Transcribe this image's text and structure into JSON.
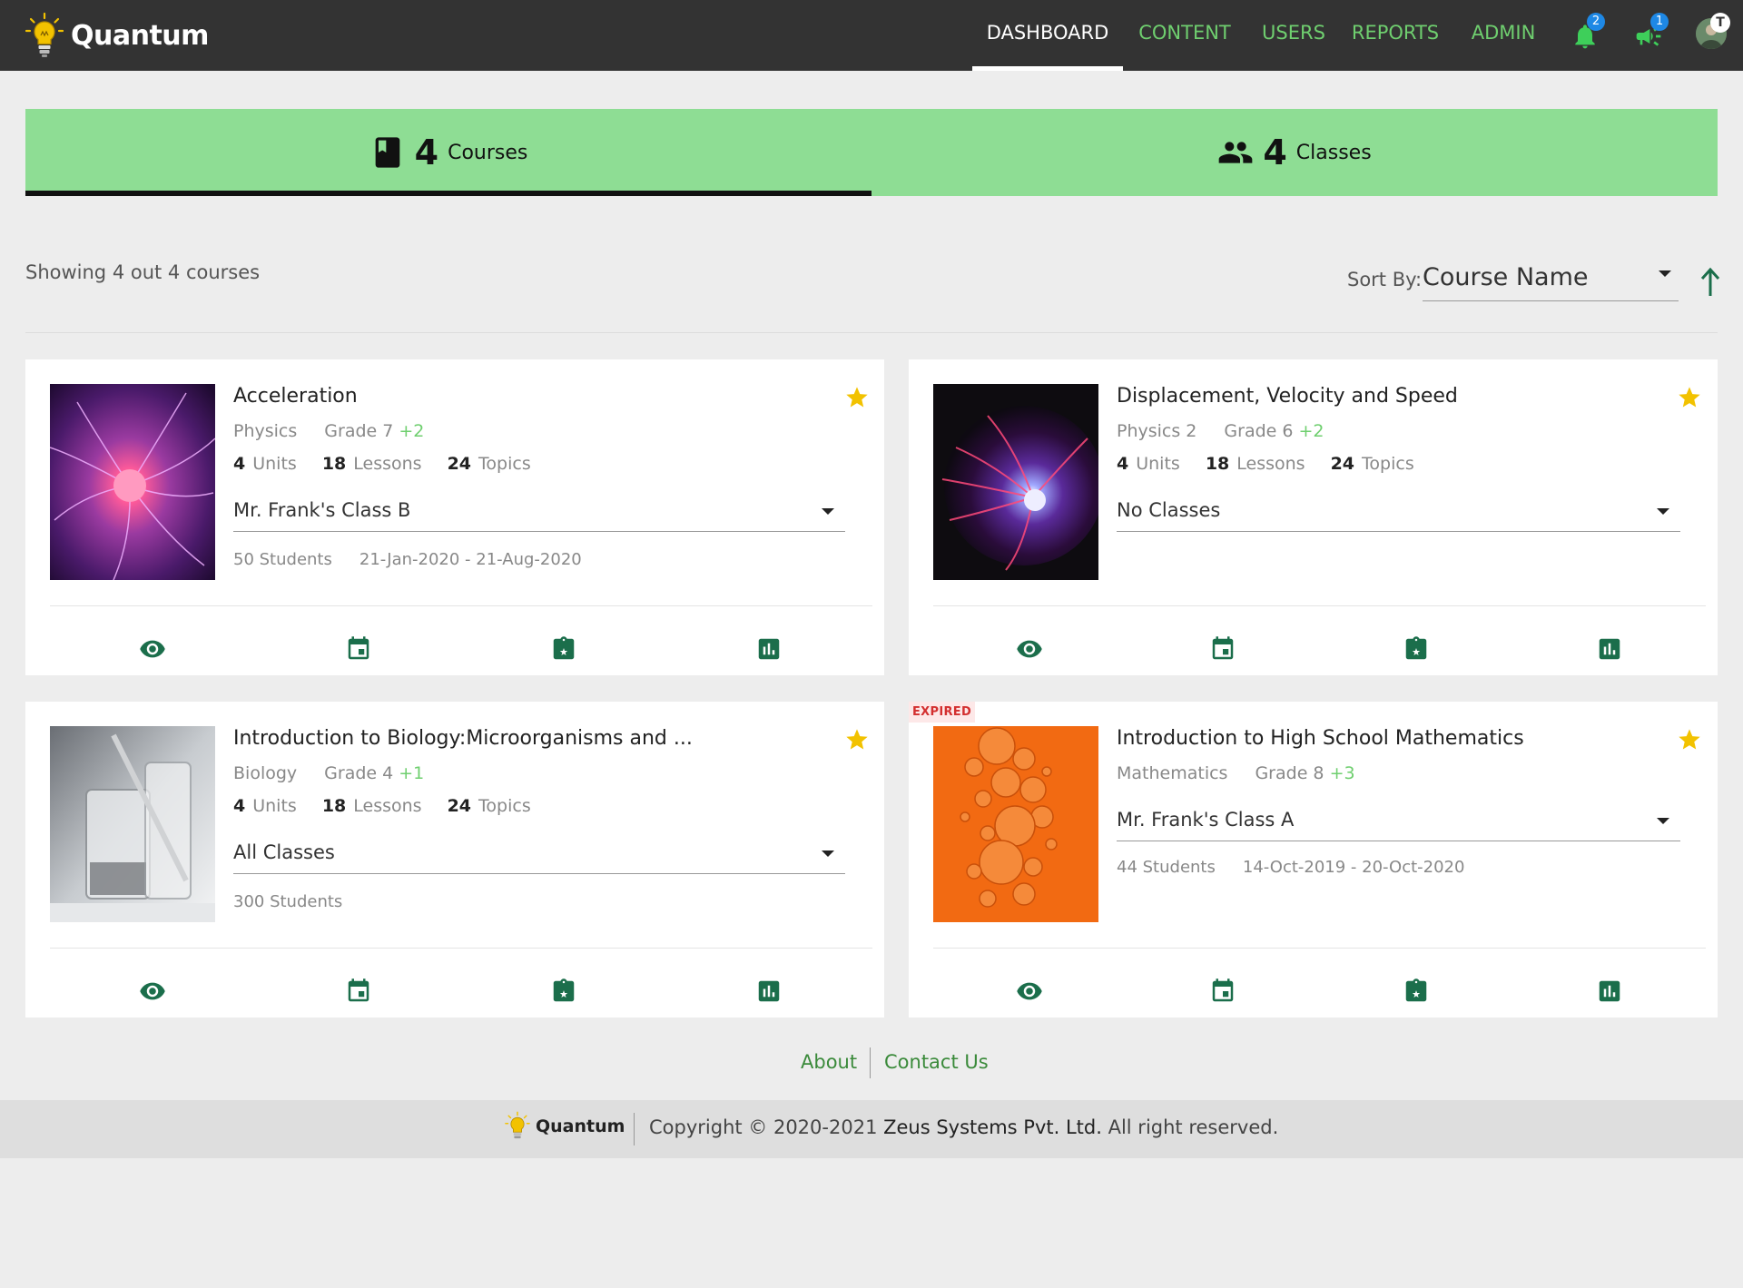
{
  "app": {
    "name": "Quantum"
  },
  "nav": {
    "items": [
      {
        "label": "DASHBOARD",
        "active": true
      },
      {
        "label": "CONTENT",
        "active": false
      },
      {
        "label": "USERS",
        "active": false
      },
      {
        "label": "REPORTS",
        "active": false
      },
      {
        "label": "ADMIN",
        "active": false
      }
    ],
    "notifications_count": "2",
    "announcements_count": "1",
    "avatar_initial": "T"
  },
  "tabs": {
    "courses": {
      "count": "4",
      "label": "Courses",
      "icon": "book-icon"
    },
    "classes": {
      "count": "4",
      "label": "Classes",
      "icon": "people-icon"
    }
  },
  "toolbar": {
    "showing_text": "Showing 4 out 4 courses",
    "sort_label": "Sort By:",
    "sort_value": "Course Name",
    "sort_direction": "ascending"
  },
  "courses": [
    {
      "title": "Acceleration",
      "subject": "Physics",
      "grade": "Grade 7",
      "grade_extra": "+2",
      "units": "4",
      "units_label": "Units",
      "lessons": "18",
      "lessons_label": "Lessons",
      "topics": "24",
      "topics_label": "Topics",
      "class_selected": "Mr. Frank's Class B",
      "students": "50 Students",
      "dates": "21-Jan-2020 - 21-Aug-2020",
      "starred": true,
      "expired": ""
    },
    {
      "title": "Displacement, Velocity and Speed",
      "subject": "Physics 2",
      "grade": "Grade 6",
      "grade_extra": "+2",
      "units": "4",
      "units_label": "Units",
      "lessons": "18",
      "lessons_label": "Lessons",
      "topics": "24",
      "topics_label": "Topics",
      "class_selected": "No Classes",
      "students": "",
      "dates": "",
      "starred": true,
      "expired": ""
    },
    {
      "title": "Introduction to Biology:Microorganisms and ...",
      "subject": "Biology",
      "grade": "Grade 4",
      "grade_extra": "+1",
      "units": "4",
      "units_label": "Units",
      "lessons": "18",
      "lessons_label": "Lessons",
      "topics": "24",
      "topics_label": "Topics",
      "class_selected": "All Classes",
      "students": "300 Students",
      "dates": "",
      "starred": true,
      "expired": ""
    },
    {
      "title": "Introduction to High School Mathematics",
      "subject": "Mathematics",
      "grade": "Grade 8",
      "grade_extra": "+3",
      "class_selected": "Mr. Frank's Class A",
      "students": "44 Students",
      "dates": "14-Oct-2019 - 20-Oct-2020",
      "starred": true,
      "expired": "EXPIRED"
    }
  ],
  "card_actions": [
    "view-icon",
    "calendar-icon",
    "bookmark-star-icon",
    "report-chart-icon"
  ],
  "footer": {
    "about": "About",
    "contact": "Contact Us",
    "logo_text": "Quantum",
    "copyright_prefix": "Copyright © 2020-2021",
    "company": "Zeus Systems Pvt. Ltd.",
    "copyright_suffix": "All right reserved."
  },
  "colors": {
    "topbar": "#333333",
    "nav_green": "#6fcf6f",
    "tab_bg": "#8edd94",
    "icon_green": "#1b6e4b",
    "star": "#f2c200",
    "expired_red": "#d32f2f"
  }
}
